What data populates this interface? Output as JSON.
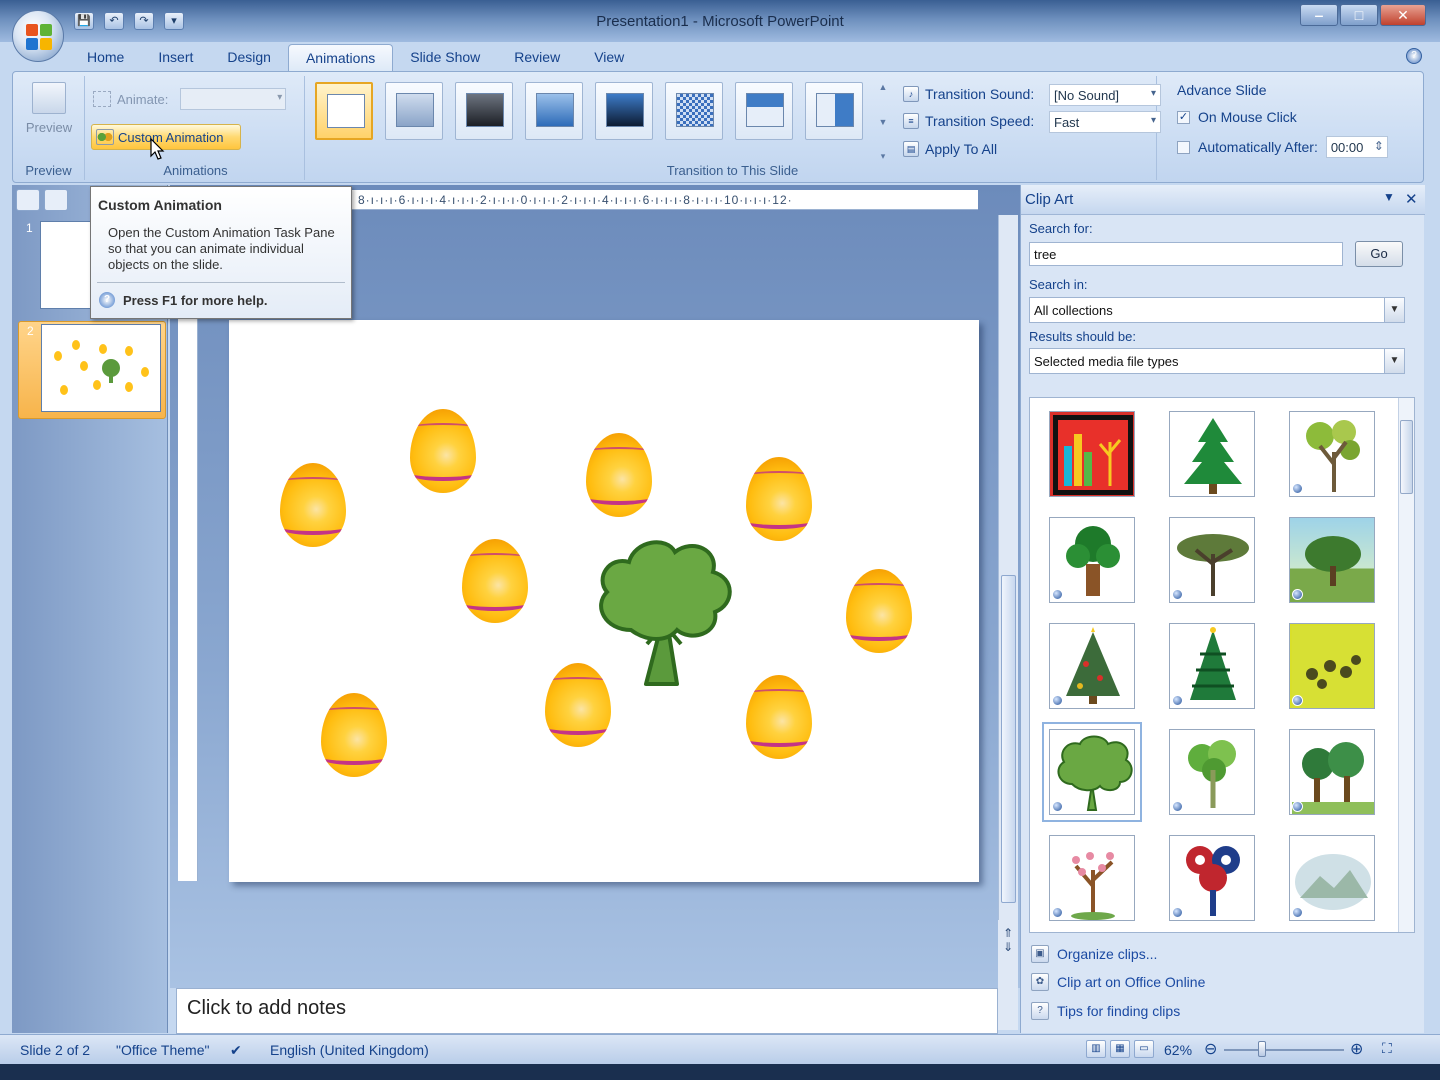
{
  "window": {
    "title": "Presentation1 - Microsoft PowerPoint",
    "controls": {
      "minimize": "‒",
      "maximize": "□",
      "close": "✕"
    }
  },
  "quick_access": {
    "save": "💾",
    "undo": "↶",
    "redo": "↷",
    "customize": "▾"
  },
  "tabs": [
    "Home",
    "Insert",
    "Design",
    "Animations",
    "Slide Show",
    "Review",
    "View"
  ],
  "active_tab": "Animations",
  "ribbon": {
    "preview_group": {
      "button_label": "Preview",
      "group_label": "Preview"
    },
    "animations_group": {
      "animate_label": "Animate:",
      "animate_value": "",
      "custom_animation_label": "Custom Animation",
      "group_label": "Animations"
    },
    "transition_group": {
      "group_label": "Transition to This Slide",
      "sound_label": "Transition Sound:",
      "sound_value": "[No Sound]",
      "speed_label": "Transition Speed:",
      "speed_value": "Fast",
      "apply_all_label": "Apply To All"
    },
    "advance_group": {
      "title": "Advance Slide",
      "on_mouse_click_label": "On Mouse Click",
      "on_mouse_click_checked": true,
      "auto_after_label": "Automatically After:",
      "auto_after_checked": false,
      "auto_after_value": "00:00"
    }
  },
  "tooltip": {
    "title": "Custom Animation",
    "body": "Open the Custom Animation Task Pane so that you can animate individual objects on the slide.",
    "help": "Press F1 for more help."
  },
  "slides_pane": {
    "thumbnails": [
      {
        "number": "1"
      },
      {
        "number": "2"
      }
    ],
    "selected": 2
  },
  "ruler": {
    "horizontal": "8·ı·ı·ı·6·ı·ı·ı·4·ı·ı·ı·2·ı·ı·ı·0·ı·ı·ı·2·ı·ı·ı·4·ı·ı·ı·6·ı·ı·ı·8·ı·ı·ı·10·ı·ı·ı·12·"
  },
  "notes": {
    "placeholder": "Click to add notes"
  },
  "clip_art": {
    "title": "Clip Art",
    "search_for_label": "Search for:",
    "search_value": "tree",
    "go_label": "Go",
    "search_in_label": "Search in:",
    "search_in_value": "All collections",
    "results_label": "Results should be:",
    "results_value": "Selected media file types",
    "links": [
      "Organize clips...",
      "Clip art on Office Online",
      "Tips for finding clips"
    ]
  },
  "status": {
    "slide": "Slide 2 of 2",
    "theme": "\"Office Theme\"",
    "language": "English (United Kingdom)",
    "zoom": "62%"
  },
  "colors": {
    "tree_green": "#5b9a3c",
    "egg_gold": "#ffbd10",
    "ribbon_blue": "#c9dbf2"
  }
}
